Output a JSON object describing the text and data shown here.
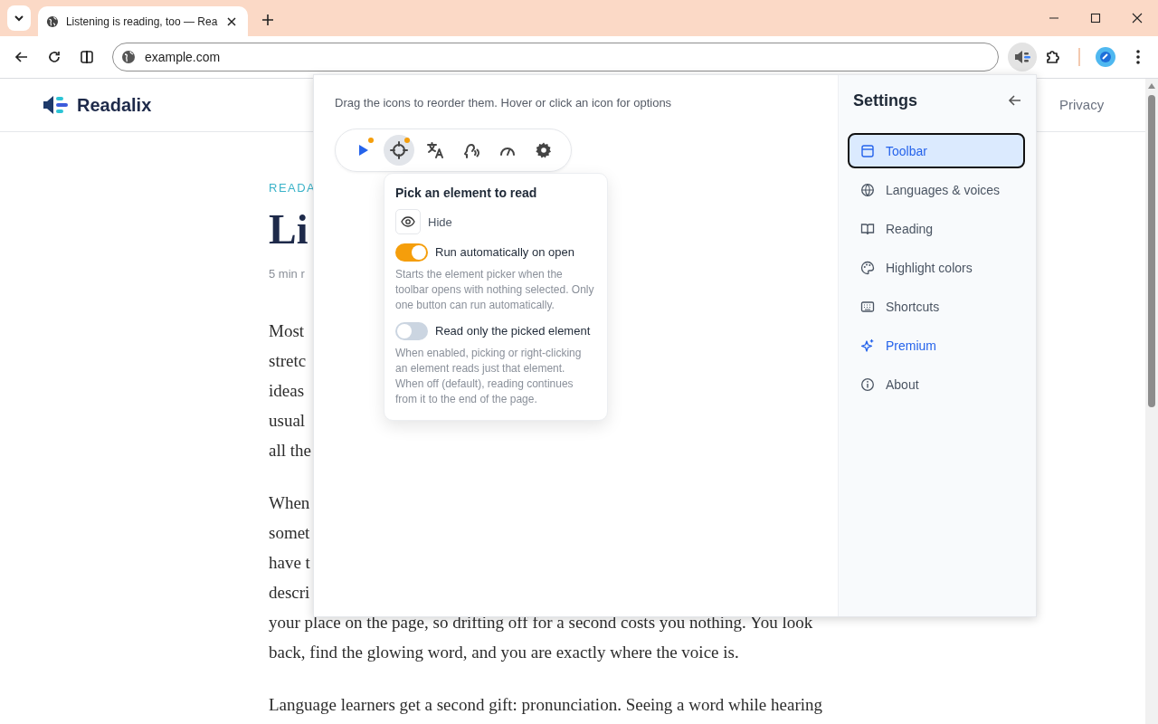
{
  "browser": {
    "tab": {
      "title": "Listening is reading, too — Rea"
    },
    "address": "example.com"
  },
  "page": {
    "logo": "Readalix",
    "nav": [
      "Privacy"
    ],
    "kicker": "READA",
    "title": "Li",
    "meta": "5 min r",
    "paragraphs": [
      {
        "lines": [
          "Most",
          "stretc",
          "ideas",
          "usual",
          "all the"
        ]
      },
      {
        "lines": [
          "When",
          "somet",
          "have t",
          "descri",
          "your place on the page, so drifting off for a second costs you nothing. You look",
          "back, find the glowing word, and you are exactly where the voice is."
        ]
      },
      {
        "lines": [
          "Language learners get a second gift: pronunciation. Seeing a word while hearing"
        ]
      }
    ]
  },
  "panel": {
    "hint": "Drag the icons to reorder them. Hover or click an icon for options",
    "tools": [
      {
        "selected": false,
        "badge": true
      },
      {
        "selected": true,
        "badge": true
      },
      {
        "selected": false,
        "badge": false
      },
      {
        "selected": false,
        "badge": false
      },
      {
        "selected": false,
        "badge": false
      },
      {
        "selected": false,
        "badge": false
      }
    ],
    "popover": {
      "title": "Pick an element to read",
      "hide_label": "Hide",
      "options": [
        {
          "label": "Run automatically on open",
          "on": true,
          "description": "Starts the element picker when the toolbar opens with nothing selected. Only one button can run automatically."
        },
        {
          "label": "Read only the picked element",
          "on": false,
          "description": "When enabled, picking or right-clicking an element reads just that element. When off (default), reading continues from it to the end of the page."
        }
      ]
    },
    "settings": {
      "title": "Settings",
      "items": [
        {
          "label": "Toolbar",
          "selected": true,
          "kind": "normal"
        },
        {
          "label": "Languages & voices",
          "selected": false,
          "kind": "normal"
        },
        {
          "label": "Reading",
          "selected": false,
          "kind": "normal"
        },
        {
          "label": "Highlight colors",
          "selected": false,
          "kind": "normal"
        },
        {
          "label": "Shortcuts",
          "selected": false,
          "kind": "normal"
        },
        {
          "label": "Premium",
          "selected": false,
          "kind": "premium"
        },
        {
          "label": "About",
          "selected": false,
          "kind": "normal"
        }
      ]
    }
  }
}
